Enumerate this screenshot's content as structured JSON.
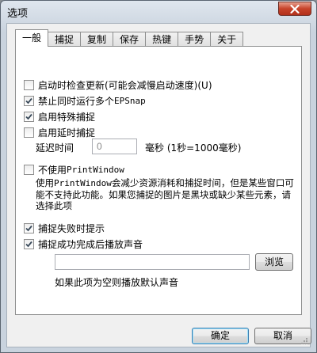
{
  "window": {
    "title": "选项",
    "colors": {
      "close_button": "#c7432a",
      "frame": "#c9d3de"
    }
  },
  "tabs": [
    {
      "label": "一般",
      "active": true
    },
    {
      "label": "捕捉",
      "active": false
    },
    {
      "label": "复制",
      "active": false
    },
    {
      "label": "保存",
      "active": false
    },
    {
      "label": "热键",
      "active": false
    },
    {
      "label": "手势",
      "active": false
    },
    {
      "label": "关于",
      "active": false
    }
  ],
  "general": {
    "check_update": {
      "label": "启动时检查更新(可能会减慢启动速度)(U)",
      "checked": false
    },
    "single_instance": {
      "label": "禁止同时运行多个",
      "label_mono": "EPSnap",
      "checked": true
    },
    "special_capture": {
      "label": "启用特殊捕捉",
      "checked": true
    },
    "delay_capture": {
      "label": "启用延时捕捉",
      "checked": false
    },
    "delay": {
      "label": "延迟时间",
      "value": "0",
      "unit": "毫秒 (1秒=1000毫秒)"
    },
    "no_printwindow": {
      "label": "不使用",
      "label_mono": "PrintWindow",
      "checked": false
    },
    "printwindow_desc": {
      "prefix": "使用",
      "mono": "PrintWindow",
      "text": "会减少资源消耗和捕捉时间，但是某些窗口可能不支持此功能。如果您捕捉的图片是黑块或缺少某些元素，请选择此项"
    },
    "fail_tip": {
      "label": "捕捉失败时提示",
      "checked": true
    },
    "play_sound": {
      "label": "捕捉成功完成后播放声音",
      "checked": true
    },
    "sound_path": {
      "value": "",
      "placeholder": ""
    },
    "browse_label": "浏览",
    "sound_hint": "如果此项为空则播放默认声音"
  },
  "footer": {
    "ok_label": "确定",
    "cancel_label": "取消"
  }
}
